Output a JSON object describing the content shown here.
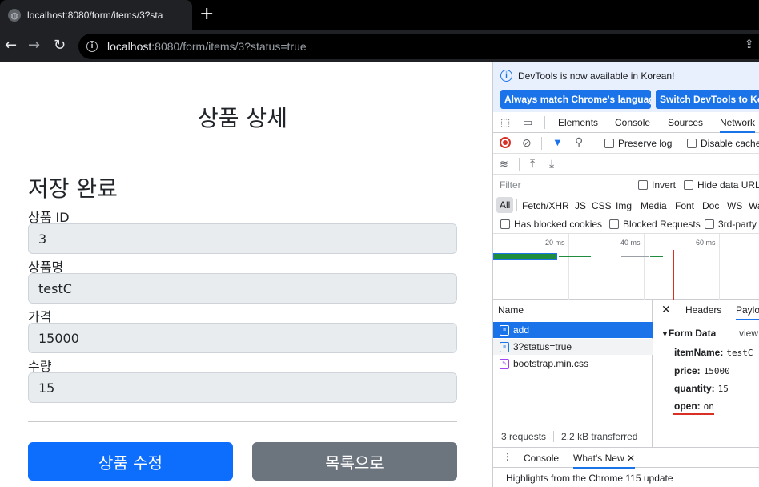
{
  "browser": {
    "tab_title": "localhost:8080/form/items/3?sta",
    "new_tab_label": "+",
    "url_host": "localhost",
    "url_rest": ":8080/form/items/3?status=true"
  },
  "page": {
    "title": "상품 상세",
    "status_message": "저장 완료",
    "fields": [
      {
        "label": "상품 ID",
        "value": "3"
      },
      {
        "label": "상품명",
        "value": "testC"
      },
      {
        "label": "가격",
        "value": "15000"
      },
      {
        "label": "수량",
        "value": "15"
      }
    ],
    "edit_button": "상품 수정",
    "list_button": "목록으로",
    "colors": {
      "primary": "#0d6efd",
      "secondary": "#6c757d",
      "input_bg": "#e9ecef"
    }
  },
  "devtools": {
    "banner_text": "DevTools is now available in Korean!",
    "banner_btn_match": "Always match Chrome's language",
    "banner_btn_switch": "Switch DevTools to Kore",
    "tabs": [
      "Elements",
      "Console",
      "Sources",
      "Network"
    ],
    "active_tab": "Network",
    "preserve_log": "Preserve log",
    "disable_cache": "Disable cache",
    "filter_placeholder": "Filter",
    "invert": "Invert",
    "hide_data_urls": "Hide data URL",
    "type_filters": [
      "All",
      "Fetch/XHR",
      "JS",
      "CSS",
      "Img",
      "Media",
      "Font",
      "Doc",
      "WS",
      "Wa"
    ],
    "blocked_cookies": "Has blocked cookies",
    "blocked_requests": "Blocked Requests",
    "third_party": "3rd-party",
    "timeline_ticks": [
      "20 ms",
      "40 ms",
      "60 ms"
    ],
    "name_header": "Name",
    "requests": [
      {
        "name": "add",
        "type": "doc",
        "selected": true
      },
      {
        "name": "3?status=true",
        "type": "doc",
        "selected": false
      },
      {
        "name": "bootstrap.min.css",
        "type": "css",
        "selected": false
      }
    ],
    "footer_requests": "3 requests",
    "footer_transferred": "2.2 kB transferred",
    "detail_tabs": [
      "Headers",
      "Paylo"
    ],
    "form_data_title": "Form Data",
    "view_source": "view",
    "form_data": [
      {
        "key": "itemName:",
        "value": "testC"
      },
      {
        "key": "price:",
        "value": "15000"
      },
      {
        "key": "quantity:",
        "value": "15"
      },
      {
        "key": "open:",
        "value": "on"
      }
    ],
    "drawer_tabs": [
      "Console",
      "What's New"
    ],
    "drawer_message": "Highlights from the Chrome 115 update"
  }
}
